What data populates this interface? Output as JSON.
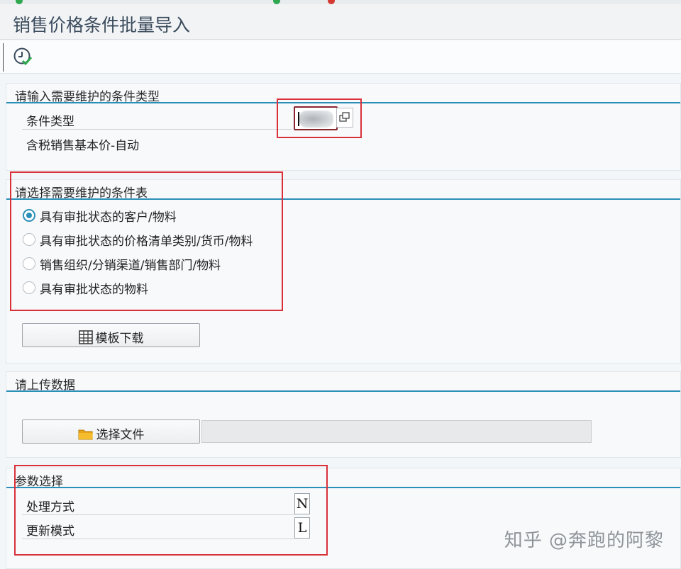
{
  "window": {
    "title": "销售价格条件批量导入"
  },
  "toolbar": {
    "execute_icon": "execute-clock-check-icon"
  },
  "section_condition_type": {
    "title": "请输入需要维护的条件类型",
    "field_label": "条件类型",
    "description": "含税销售基本价-自动"
  },
  "section_condition_table": {
    "title": "请选择需要维护的条件表",
    "options": [
      {
        "label": "具有审批状态的客户/物料",
        "selected": true
      },
      {
        "label": "具有审批状态的价格清单类别/货币/物料",
        "selected": false
      },
      {
        "label": "销售组织/分销渠道/销售部门/物料",
        "selected": false
      },
      {
        "label": "具有审批状态的物料",
        "selected": false
      }
    ],
    "download_button": "模板下载"
  },
  "section_upload": {
    "title": "请上传数据",
    "choose_file_button": "选择文件"
  },
  "section_params": {
    "title": "参数选择",
    "processing_mode_label": "处理方式",
    "processing_mode_value": "N",
    "update_mode_label": "更新模式",
    "update_mode_value": "L"
  },
  "watermark": "知乎 @奔跑的阿黎",
  "colors": {
    "accent": "#2a8fb8",
    "highlight_box": "#d9303a"
  }
}
